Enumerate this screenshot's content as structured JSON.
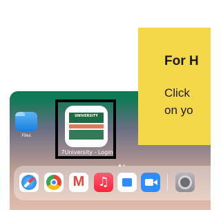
{
  "home_screen": {
    "apps": [
      {
        "label": "Files",
        "icon": "folder-icon"
      },
      {
        "label": "7University - Login",
        "icon": "university-icon",
        "selected": true
      }
    ],
    "university_icon_text": "UNIVERSITY",
    "dock": [
      "safari-icon",
      "chrome-icon",
      "gmail-icon",
      "music-icon",
      "calendar-icon",
      "zoom-icon",
      "settings-icon"
    ]
  },
  "callout": {
    "title": "For H",
    "body_line1": "Click",
    "body_line2": "on yo",
    "color": "#f5d84a"
  }
}
